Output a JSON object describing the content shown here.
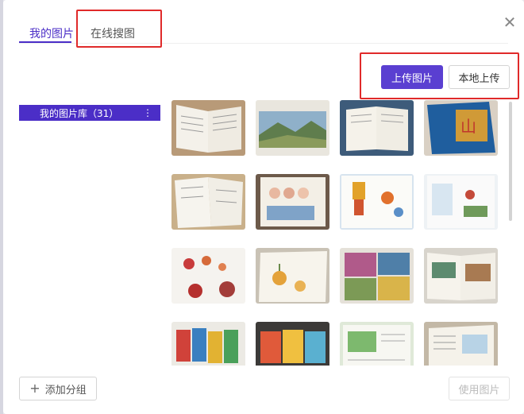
{
  "dialog": {
    "close_icon": "close-icon"
  },
  "tabs": [
    {
      "label": "我的图片",
      "active": true
    },
    {
      "label": "在线搜图",
      "active": false
    }
  ],
  "toolbar": {
    "upload_label": "上传图片",
    "local_upload_label": "本地上传"
  },
  "sidebar": {
    "items": [
      {
        "label": "我的图片库（31）",
        "more_icon": "more-vertical-icon",
        "more_glyph": "⋮"
      }
    ]
  },
  "footer": {
    "add_group_label": "添加分组",
    "add_icon": "plus-icon",
    "use_label": "使用图片"
  },
  "annotations": {
    "color": "#e02a2a"
  },
  "colors": {
    "accent": "#4b2ec7",
    "primary_button": "#5a3fd1"
  },
  "images": [
    {
      "name": "open-book-photo"
    },
    {
      "name": "landscape-page-photo"
    },
    {
      "name": "open-book-desk-photo"
    },
    {
      "name": "blue-cover-book-photo"
    },
    {
      "name": "open-workbook-photo"
    },
    {
      "name": "children-book-faces-photo"
    },
    {
      "name": "illustrated-book-robot-photo"
    },
    {
      "name": "illustrated-book-map-photo"
    },
    {
      "name": "fruit-illustration-photo"
    },
    {
      "name": "lantern-plant-book-photo"
    },
    {
      "name": "magazine-collage-photo"
    },
    {
      "name": "open-book-pictures-photo"
    },
    {
      "name": "snack-packets-photo"
    },
    {
      "name": "snack-bags-photo"
    },
    {
      "name": "green-book-page-photo"
    },
    {
      "name": "book-diagram-photo"
    }
  ]
}
